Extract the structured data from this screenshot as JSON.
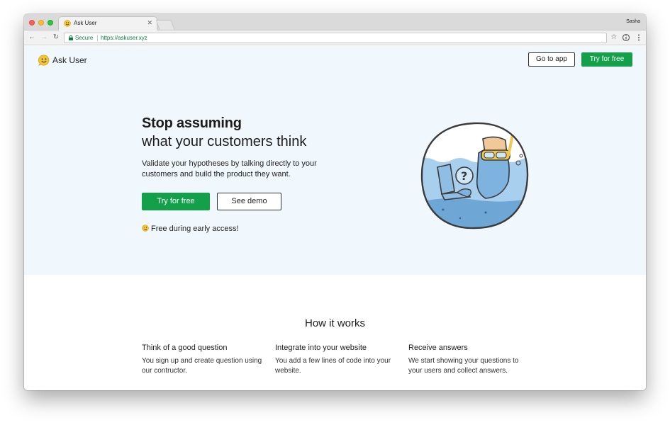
{
  "browser": {
    "tab_title": "Ask User",
    "profile_name": "Sasha",
    "secure_label": "Secure",
    "url": "https://askuser.xyz"
  },
  "nav": {
    "brand": "Ask User",
    "go_to_app": "Go to app",
    "try_for_free": "Try for free"
  },
  "hero": {
    "headline_line1": "Stop assuming",
    "headline_line2": "what your customers think",
    "description": "Validate your hypotheses by talking directly to your customers and build the product they want.",
    "try_for_free": "Try for free",
    "see_demo": "See demo",
    "free_note": "Free during early access!"
  },
  "how_it_works": {
    "title": "How it works",
    "steps": [
      {
        "title": "Think of a good question",
        "description": "You sign up and create question using our contructor."
      },
      {
        "title": "Integrate into your website",
        "description": "You add a few lines of code into your website."
      },
      {
        "title": "Receive answers",
        "description": "We start showing your questions to your users and collect answers."
      }
    ]
  },
  "colors": {
    "accent_green": "#14a04a",
    "hero_background": "#f1f8fd",
    "secure_green": "#0b8043"
  },
  "icons": [
    "smiley-logo-icon",
    "lock-icon",
    "star-icon",
    "info-icon",
    "menu-icon",
    "back-icon",
    "forward-icon",
    "reload-icon",
    "tab-close-icon"
  ]
}
